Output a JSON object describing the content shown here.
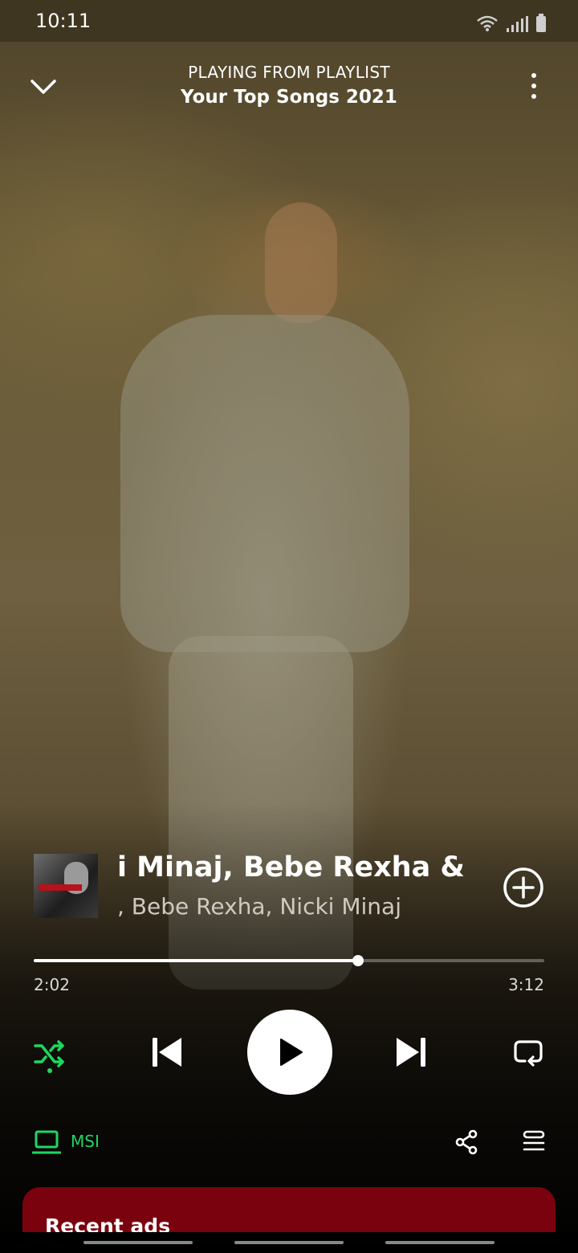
{
  "status_bar": {
    "time": "10:11"
  },
  "header": {
    "context_label": "PLAYING FROM PLAYLIST",
    "playlist_name": "Your Top Songs 2021"
  },
  "track": {
    "title": "i Minaj, Bebe Rexha & Afr",
    "artists": ", Bebe Rexha, Nicki Minaj",
    "album_art_icon": "album-cover-art"
  },
  "playback": {
    "elapsed": "2:02",
    "duration": "3:12",
    "progress_fraction": 0.635,
    "shuffle_active": true,
    "accent_color": "#1ed760"
  },
  "device": {
    "name": "MSI"
  },
  "ads_card": {
    "title": "Recent ads"
  },
  "icons": {
    "collapse": "chevron-down-icon",
    "more": "more-vertical-icon",
    "add": "add-circle-icon",
    "shuffle": "shuffle-icon",
    "previous": "skip-previous-icon",
    "play": "play-icon",
    "next": "skip-next-icon",
    "repeat": "repeat-icon",
    "device": "laptop-icon",
    "share": "share-icon",
    "queue": "queue-icon"
  }
}
